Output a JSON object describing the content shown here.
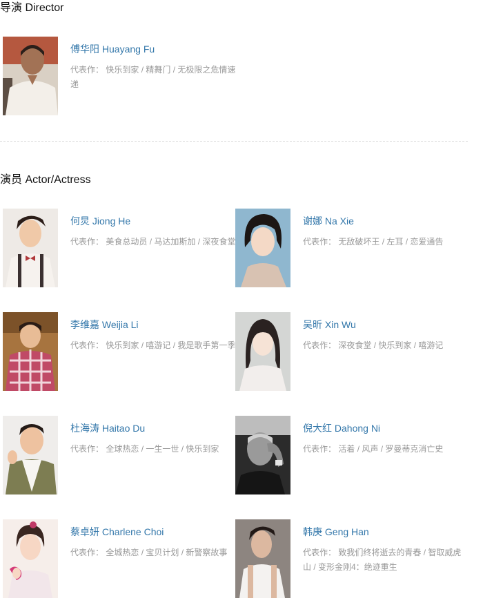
{
  "director_section": {
    "title": "导演 Director",
    "people": [
      {
        "name": "傅华阳 Huayang Fu",
        "works_label": "代表作：",
        "works": "快乐到家 / 精舞门 / 无极限之危情速递"
      }
    ]
  },
  "actor_section": {
    "title": "演员 Actor/Actress",
    "people": [
      {
        "name": "何炅 Jiong He",
        "works_label": "代表作：",
        "works": "美食总动员 / 马达加斯加 / 深夜食堂"
      },
      {
        "name": "谢娜 Na Xie",
        "works_label": "代表作：",
        "works": "无敌破坏王 / 左耳 / 恋爱通告"
      },
      {
        "name": "李维嘉 Weijia Li",
        "works_label": "代表作：",
        "works": "快乐到家 / 嘻游记 / 我是歌手第一季"
      },
      {
        "name": "吴昕 Xin Wu",
        "works_label": "代表作：",
        "works": "深夜食堂 / 快乐到家 / 嘻游记"
      },
      {
        "name": "杜海涛 Haitao Du",
        "works_label": "代表作：",
        "works": "全球热恋 / 一生一世 / 快乐到家"
      },
      {
        "name": "倪大红 Dahong Ni",
        "works_label": "代表作：",
        "works": "活着 / 风声 / 罗曼蒂克消亡史"
      },
      {
        "name": "蔡卓妍 Charlene Choi",
        "works_label": "代表作：",
        "works": "全城热恋 / 宝贝计划 / 新警察故事"
      },
      {
        "name": "韩庚 Geng Han",
        "works_label": "代表作：",
        "works": "致我们终将逝去的青春 / 智取威虎山 / 变形金刚4：绝迹重生"
      }
    ]
  }
}
